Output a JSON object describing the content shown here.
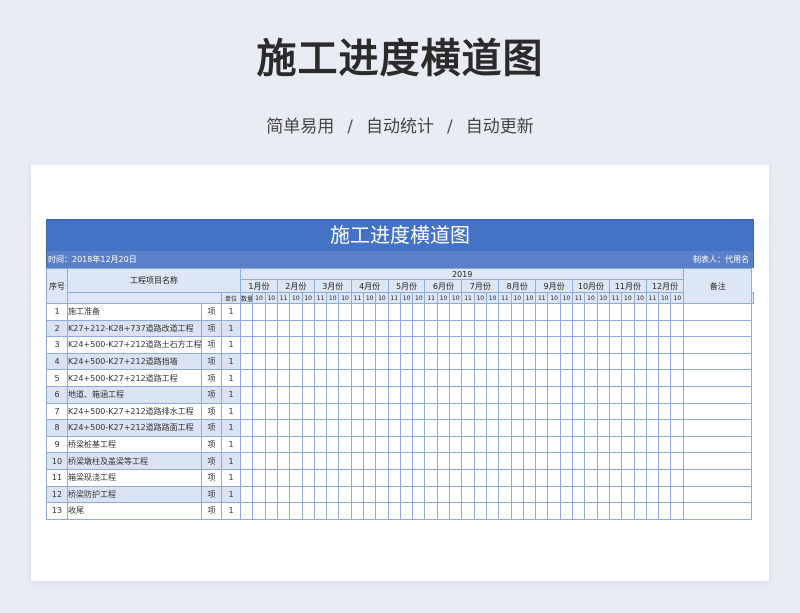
{
  "hero": {
    "title": "施工进度横道图",
    "tags": [
      "简单易用",
      "自动统计",
      "自动更新"
    ],
    "separator": "/"
  },
  "sheet": {
    "title": "施工进度横道图",
    "time_label": "时间：2018年12月20日",
    "author_label": "制表人：代用名",
    "colors": {
      "header_blue": "#4472c4",
      "info_blue": "#5b80c8",
      "row_alt": "#dae3f3",
      "grid_line": "#8faadc",
      "head_fill": "#dce6f4"
    },
    "headers": {
      "seq": "序号",
      "name": "工程项目名称",
      "unit": "单位",
      "qty": "数量",
      "year": "2019",
      "remark": "备注"
    },
    "months": [
      "1月份",
      "2月份",
      "3月份",
      "4月份",
      "5月份",
      "6月份",
      "7月份",
      "8月份",
      "9月份",
      "10月份",
      "11月份",
      "12月份"
    ],
    "days": [
      "10",
      "10",
      "11"
    ],
    "rows": [
      {
        "seq": "1",
        "name": "施工准备",
        "unit": "项",
        "qty": "1"
      },
      {
        "seq": "2",
        "name": "K27+212-K28+737道路改道工程",
        "unit": "项",
        "qty": "1"
      },
      {
        "seq": "3",
        "name": "K24+500-K27+212道路土石方工程",
        "unit": "项",
        "qty": "1"
      },
      {
        "seq": "4",
        "name": "K24+500-K27+212道路挡墙",
        "unit": "项",
        "qty": "1"
      },
      {
        "seq": "5",
        "name": "K24+500-K27+212道路工程",
        "unit": "项",
        "qty": "1"
      },
      {
        "seq": "6",
        "name": "地道、箱涵工程",
        "unit": "项",
        "qty": "1"
      },
      {
        "seq": "7",
        "name": "K24+500-K27+212道路排水工程",
        "unit": "项",
        "qty": "1"
      },
      {
        "seq": "8",
        "name": "K24+500-K27+212道路路面工程",
        "unit": "项",
        "qty": "1"
      },
      {
        "seq": "9",
        "name": "桥梁桩基工程",
        "unit": "项",
        "qty": "1"
      },
      {
        "seq": "10",
        "name": "桥梁墩柱及盖梁等工程",
        "unit": "项",
        "qty": "1"
      },
      {
        "seq": "11",
        "name": "箱梁现浇工程",
        "unit": "项",
        "qty": "1"
      },
      {
        "seq": "12",
        "name": "桥梁防护工程",
        "unit": "项",
        "qty": "1"
      },
      {
        "seq": "13",
        "name": "收尾",
        "unit": "项",
        "qty": "1"
      }
    ]
  }
}
